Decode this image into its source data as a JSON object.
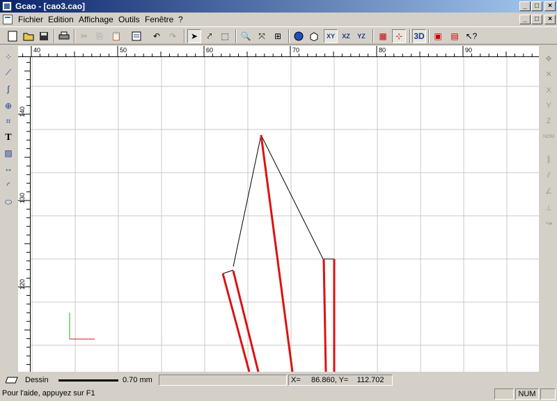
{
  "window": {
    "title": "Gcao - [cao3.cao]"
  },
  "menu": {
    "items": [
      "Fichier",
      "Edition",
      "Affichage",
      "Outils",
      "Fenêtre",
      "?"
    ]
  },
  "rulers": {
    "h_ticks": [
      {
        "label": "40",
        "value": 40
      },
      {
        "label": "50",
        "value": 50
      },
      {
        "label": "60",
        "value": 60
      },
      {
        "label": "70",
        "value": 70
      },
      {
        "label": "80",
        "value": 80
      },
      {
        "label": "90",
        "value": 90
      }
    ],
    "v_ticks": [
      {
        "label": "140",
        "value": 140
      },
      {
        "label": "130",
        "value": 130
      },
      {
        "label": "120",
        "value": 120
      }
    ]
  },
  "toolbar": {
    "view_3d_label": "3D"
  },
  "status": {
    "layer_label": "Dessin",
    "line_width": "0.70 mm",
    "coords": "X=     86.860, Y=    112.702",
    "help_text": "Pour l'aide, appuyez sur F1",
    "num_indicator": "NUM"
  },
  "colors": {
    "accent": "#0a246a",
    "drawing_red": "#dd1111",
    "grid": "#c8c8c8"
  }
}
